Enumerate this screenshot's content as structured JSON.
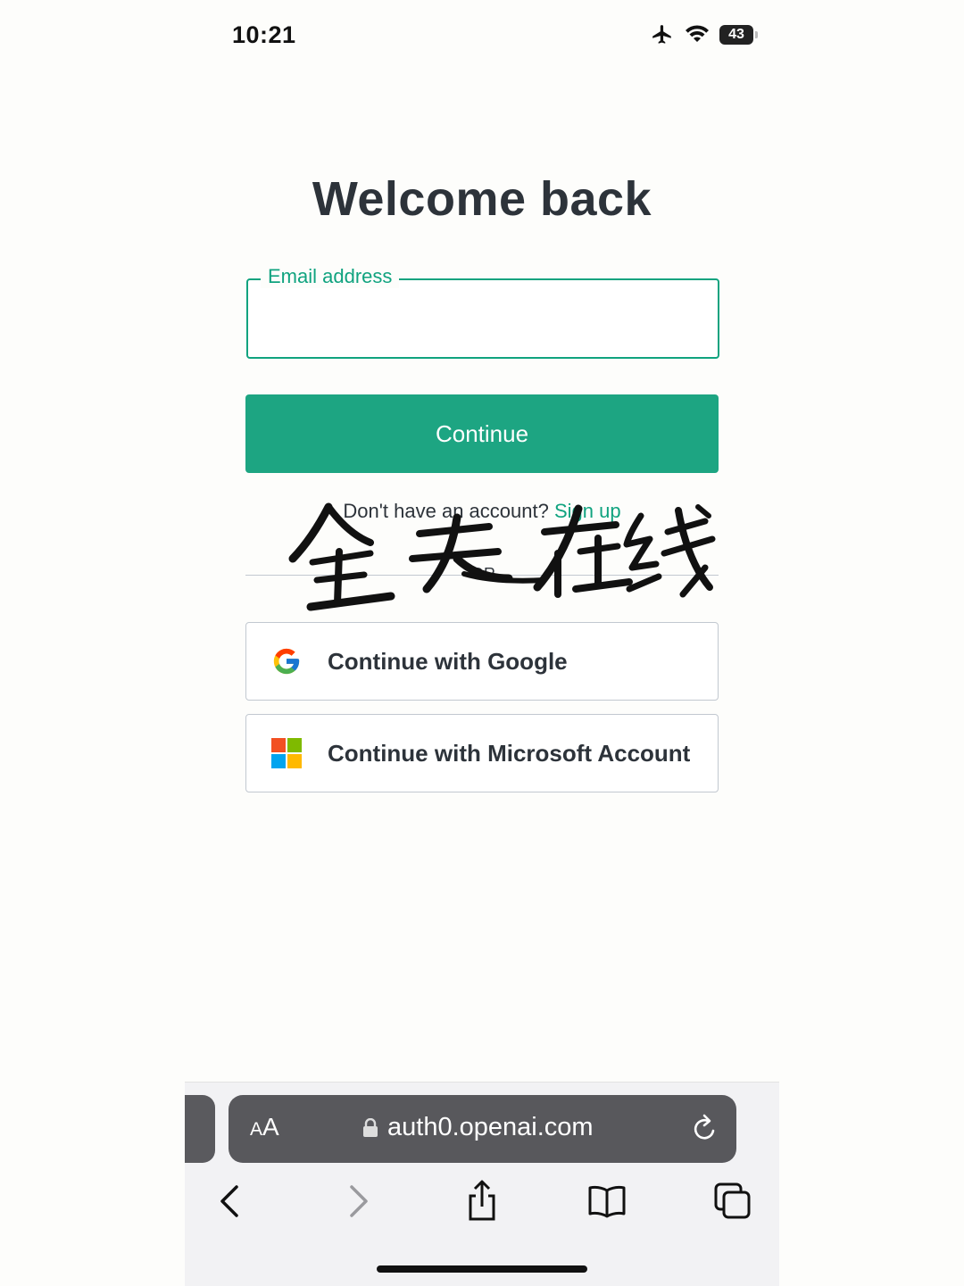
{
  "status_bar": {
    "time": "10:21",
    "battery": "43",
    "icons": [
      "airplane-icon",
      "wifi-icon",
      "battery-icon"
    ]
  },
  "login": {
    "title": "Welcome back",
    "email_label": "Email address",
    "email_value": "",
    "continue_label": "Continue",
    "signup_prompt": "Don't have an account?",
    "signup_link": "Sign up",
    "or_text": "OR",
    "google_label": "Continue with Google",
    "microsoft_label": "Continue with Microsoft Account"
  },
  "overlay_text": "全天在线",
  "browser": {
    "text_size_label_small": "A",
    "text_size_label_large": "A",
    "url": "auth0.openai.com",
    "toolbar_icons": [
      "back-icon",
      "forward-icon",
      "share-icon",
      "bookmarks-icon",
      "tabs-icon"
    ]
  },
  "colors": {
    "accent": "#10a37f",
    "button": "#1da582",
    "text": "#2d333a",
    "url_bar": "#58585c"
  }
}
